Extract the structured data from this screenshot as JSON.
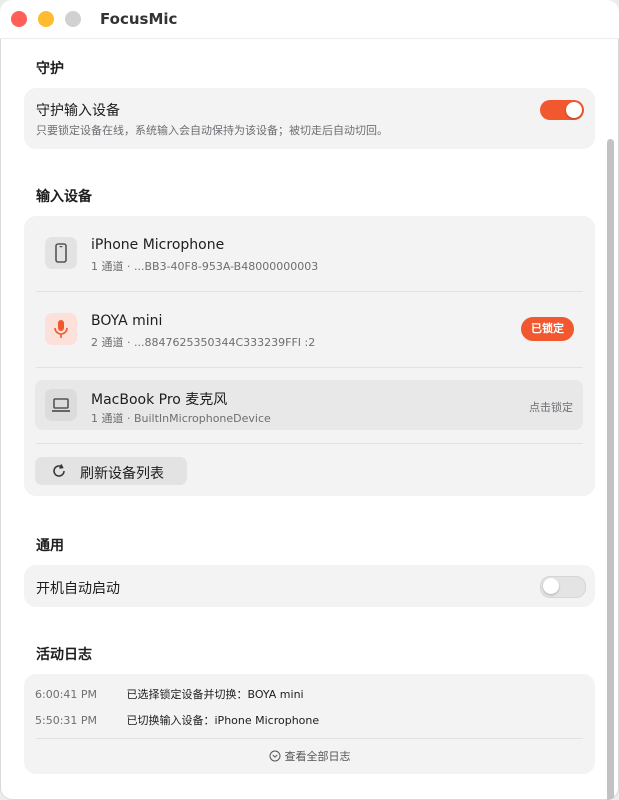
{
  "app": {
    "title": "FocusMic"
  },
  "guard": {
    "section_title": "守护",
    "title": "守护输入设备",
    "subtitle": "只要锁定设备在线，系统输入会自动保持为该设备；被切走后自动切回。",
    "toggle_on": true
  },
  "devices": {
    "section_title": "输入设备",
    "items": [
      {
        "name": "iPhone Microphone",
        "detail": "1 通道 · ...BB3-40F8-953A-B48000000003",
        "icon": "phone-icon"
      },
      {
        "name": "BOYA mini",
        "detail": "2 通道 · ...884762535034​4C333239FFI :2",
        "icon": "mic-icon",
        "badge": "已锁定"
      },
      {
        "name": "MacBook Pro 麦克风",
        "detail": "1 通道 · BuiltInMicrophoneDevice",
        "icon": "laptop-icon",
        "action": "点击锁定"
      }
    ],
    "refresh_label": "刷新设备列表"
  },
  "general": {
    "section_title": "通用",
    "autostart_label": "开机自动启动",
    "toggle_on": false
  },
  "log": {
    "section_title": "活动日志",
    "entries": [
      {
        "time": "6:00:41 PM",
        "text": "已选择锁定设备并切换：BOYA mini"
      },
      {
        "time": "5:50:31 PM",
        "text": "已切换输入设备：iPhone Microphone"
      }
    ],
    "view_all": "查看全部日志"
  },
  "colors": {
    "accent": "#f1582f"
  }
}
